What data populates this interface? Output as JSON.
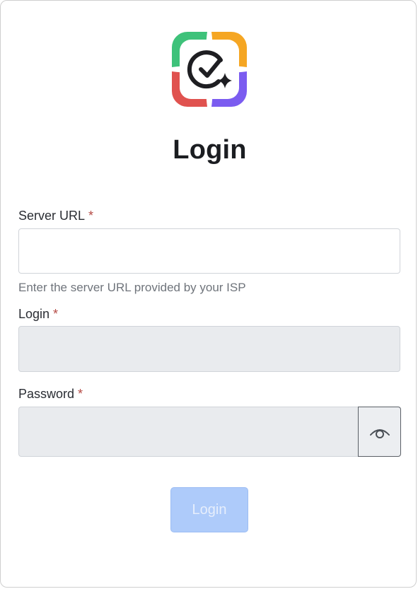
{
  "page": {
    "title": "Login"
  },
  "server_url": {
    "label": "Server URL",
    "required_mark": "*",
    "value": "",
    "placeholder": "",
    "helper": "Enter the server URL provided by your ISP"
  },
  "login": {
    "label": "Login",
    "required_mark": "*",
    "value": "",
    "placeholder": "",
    "disabled": true
  },
  "password": {
    "label": "Password",
    "required_mark": "*",
    "value": "",
    "placeholder": "",
    "disabled": true,
    "toggle_icon": "eye-icon"
  },
  "submit": {
    "label": "Login",
    "disabled": true
  },
  "colors": {
    "accent_disabled": "#aecbfa",
    "required": "#b54a44",
    "logo_green": "#3ec27a",
    "logo_orange": "#f5a623",
    "logo_red": "#e0524f",
    "logo_purple": "#7b5cf0"
  },
  "logo": {
    "icon": "check-sparkle-logo"
  }
}
